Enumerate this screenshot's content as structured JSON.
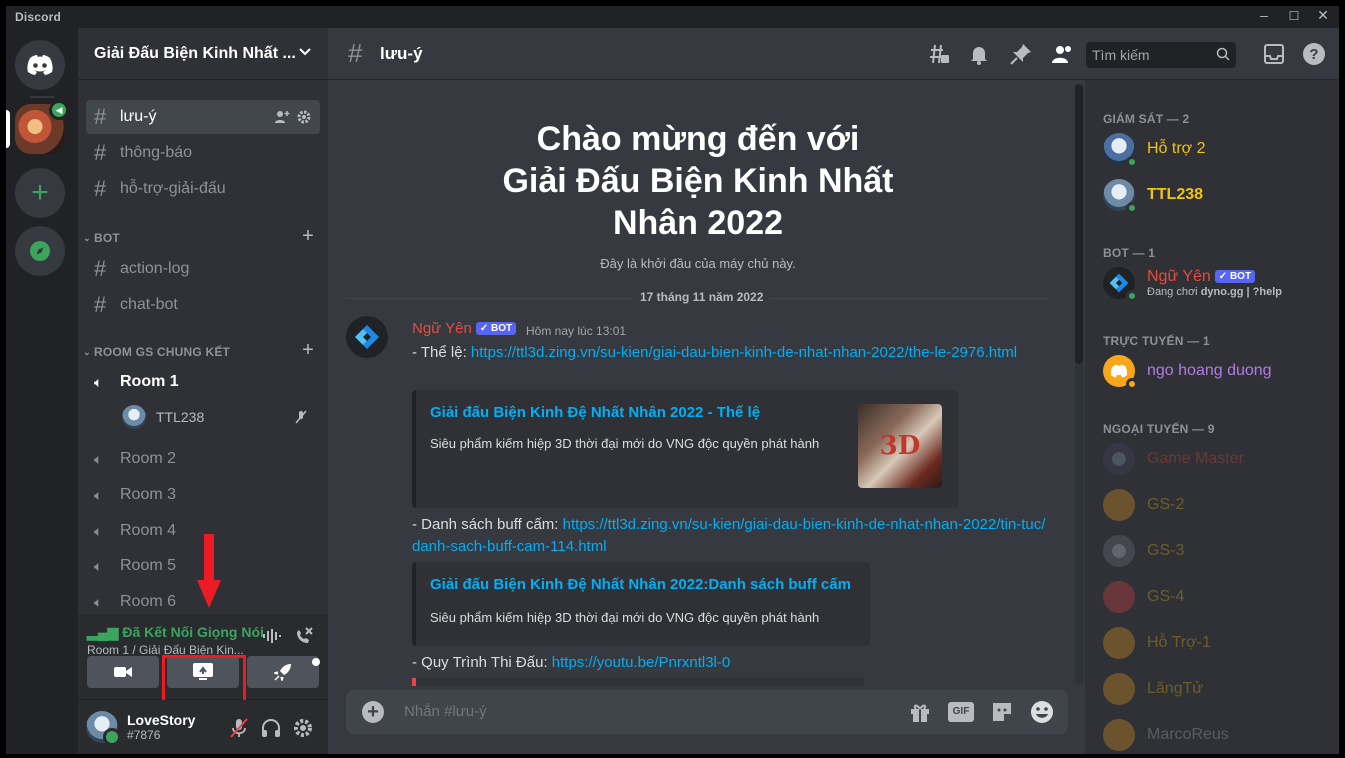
{
  "window": {
    "brand": "Discord",
    "controls": {
      "minimize": "–",
      "maximize": "☐",
      "close": "✕"
    }
  },
  "server": {
    "name": "Giải Đấu Biện Kinh Nhất ..."
  },
  "channels": [
    {
      "label": "lưu-ý",
      "active": true
    },
    {
      "label": "thông-báo"
    },
    {
      "label": "hỗ-trợ-giải-đấu"
    }
  ],
  "categories": {
    "bot": {
      "label": "BOT",
      "channels": [
        "action-log",
        "chat-bot"
      ]
    },
    "room": {
      "label": "ROOM GS CHUNG KẾT"
    }
  },
  "voice_channels": [
    "Room 1",
    "Room 2",
    "Room 3",
    "Room 4",
    "Room 5",
    "Room 6"
  ],
  "voice_user": "TTL238",
  "voice_panel": {
    "status": "Đã Kết Nối Giọng Nói",
    "location": "Room 1 / Giải Đấu Biện Kin..."
  },
  "user": {
    "name": "LoveStory",
    "tag": "#7876"
  },
  "header": {
    "channel": "lưu-ý",
    "search_placeholder": "Tìm kiếm"
  },
  "welcome": {
    "line1": "Chào mừng đến với",
    "line2": "Giải Đấu Biện Kinh Nhất",
    "line3": "Nhân 2022",
    "sub": "Đây là khởi đầu của máy chủ này."
  },
  "divider_date": "17 tháng 11 năm 2022",
  "message": {
    "author": "Ngữ Yên",
    "bot_badge": "✓ BOT",
    "timestamp": "Hôm nay lúc 13:01",
    "l1_prefix": "- Thể lệ: ",
    "l1_link": "https://ttl3d.zing.vn/su-kien/giai-dau-bien-kinh-de-nhat-nhan-2022/the-le-2976.html",
    "embed1_title": "Giải đấu Biện Kinh Đệ Nhất Nhân 2022 - Thể lệ",
    "embed1_desc": "Siêu phẩm kiếm hiệp 3D thời đại mới do VNG độc quyền phát hành",
    "l2_prefix": "- Danh sách buff cấm: ",
    "l2_link": "https://ttl3d.zing.vn/su-kien/giai-dau-bien-kinh-de-nhat-nhan-2022/tin-tuc/danh-sach-buff-cam-114.html",
    "embed2_title": "Giải đấu Biện Kinh Đệ Nhất Nhân 2022:Danh sách buff cấm",
    "embed2_desc": "Siêu phẩm kiếm hiệp 3D thời đại mới do VNG độc quyền phát hành",
    "l3_prefix": "- Quy Trình Thi Đấu: ",
    "l3_link": "https://youtu.be/Pnrxntl3l-0"
  },
  "composer": {
    "placeholder": "Nhắn #lưu-ý",
    "gif": "GIF"
  },
  "members": {
    "cat_giamsat": "GIÁM SÁT — 2",
    "cat_bot": "BOT — 1",
    "cat_online": "TRỰC TUYẾN — 1",
    "cat_offline": "NGOẠI TUYẾN — 9",
    "giamsat": [
      "Hỗ trợ 2",
      "TTL238"
    ],
    "bot": {
      "name": "Ngữ Yên",
      "badge": "✓ BOT",
      "activity_prefix": "Đang chơi ",
      "activity_game": "dyno.gg | ?help"
    },
    "online": [
      "ngo hoang duong"
    ],
    "offline": [
      "Game Master",
      "GS-2",
      "GS-3",
      "GS-4",
      "Hỗ Trợ-1",
      "LãngTử",
      "MarcoReus"
    ]
  },
  "colors": {
    "accent": "#5865f2",
    "online": "#3ba55d",
    "gold": "#f1c40f",
    "bot_name": "#e74c3c",
    "link": "#00aff4",
    "highlight": "#ed1c24"
  }
}
